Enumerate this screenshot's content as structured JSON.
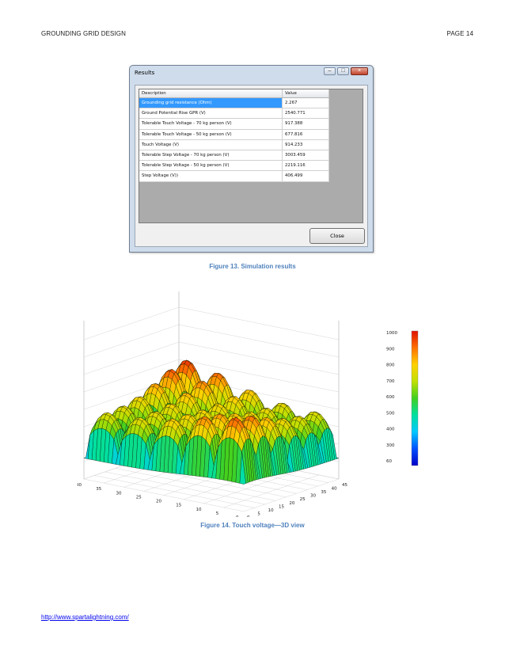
{
  "header": {
    "left": "GROUNDING GRID DESIGN",
    "right": "PAGE 14"
  },
  "dialog": {
    "title": "Results",
    "columns": [
      "Description",
      "Value"
    ],
    "rows": [
      {
        "description": "Grounding grid resistance (Ohm)",
        "value": "2.267"
      },
      {
        "description": "Ground Potential Rise GPR (V)",
        "value": "2540.771"
      },
      {
        "description": "Tolerable Touch Voltage - 70 kg person (V)",
        "value": "917.388"
      },
      {
        "description": "Tolerable Touch Voltage - 50 kg person (V)",
        "value": "677.816"
      },
      {
        "description": "Touch Voltage (V)",
        "value": "914.233"
      },
      {
        "description": "Tolerable Step Voltage - 70 kg person (V)",
        "value": "3003.459"
      },
      {
        "description": "Tolerable Step Voltage - 50 kg person (V)",
        "value": "2219.116"
      },
      {
        "description": "Step Voltage (V))",
        "value": "406.499"
      }
    ],
    "close_label": "Close",
    "minimize_glyph": "–",
    "maximize_glyph": "□",
    "close_glyph": "×"
  },
  "figure13_caption": "Figure 13.  Simulation results",
  "figure14_caption": "Figure 14.  Touch voltage—3D view",
  "footer_link": "http://www.spartalightning.com/",
  "chart_data": {
    "type": "surface3d",
    "title": "",
    "x_ticks": [
      "0",
      "5",
      "10",
      "15",
      "20",
      "25",
      "30",
      "35",
      "40",
      "45"
    ],
    "y_ticks": [
      "0",
      "5",
      "10",
      "15",
      "20",
      "25",
      "30",
      "35",
      "40"
    ],
    "colorbar_ticks": [
      "1000",
      "900",
      "800",
      "700",
      "600",
      "500",
      "400",
      "300",
      "60"
    ],
    "zlim": [
      60,
      1000
    ],
    "colormap": [
      "#0000c8",
      "#0050ff",
      "#00c8ff",
      "#00e0a0",
      "#40d020",
      "#c0e000",
      "#ffd000",
      "#ff7000",
      "#e01000"
    ]
  }
}
